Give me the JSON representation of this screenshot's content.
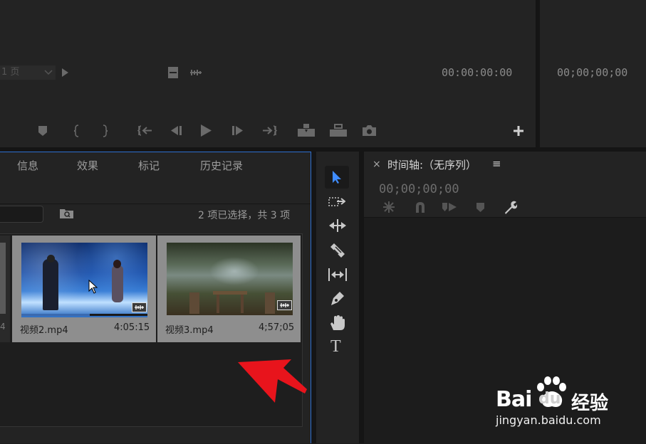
{
  "source_monitor": {
    "page_select": "1 页",
    "timecode": "00:00:00:00"
  },
  "program_monitor": {
    "timecode": "00;00;00;00"
  },
  "project_panel": {
    "tabs": [
      "信息",
      "效果",
      "标记",
      "历史记录"
    ],
    "selection_status": "2 项已选择，共 3 项",
    "clips": [
      {
        "name": "视频2.mp4",
        "duration": "4:05:15"
      },
      {
        "name": "视频3.mp4",
        "duration": "4;57;05"
      }
    ],
    "partial_clip_duration_fragment": "4"
  },
  "timeline_panel": {
    "close_glyph": "×",
    "title": "时间轴:（无序列）",
    "menu_glyph": "≡",
    "timecode": "00;00;00;00"
  },
  "tools": [
    "selection-tool",
    "track-select-tool",
    "ripple-edit-tool",
    "razor-tool",
    "slip-tool",
    "pen-tool",
    "hand-tool",
    "type-tool"
  ],
  "tool_glyphs": {
    "type": "T"
  },
  "colors": {
    "accent_blue": "#2d6fd1",
    "selection_arrow": "#3f8cff",
    "annotation_arrow": "#e8141c"
  },
  "watermark": {
    "brand_left": "Bai",
    "brand_right": "du",
    "product": "经验",
    "url": "jingyan.baidu.com"
  }
}
